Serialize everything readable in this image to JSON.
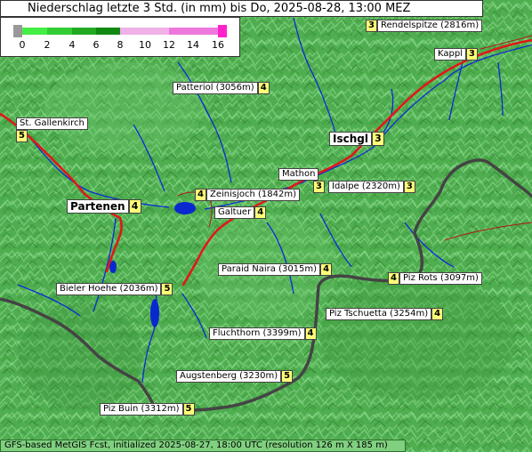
{
  "title": "Niederschlag letzte 3 Std. (in mm) bis Do, 2025-08-28, 13:00 MEZ",
  "footer": "GFS-based MetGIS Fcst, initialized 2025-08-27, 18:00 UTC  (resolution 126 m X 185 m)",
  "legend": {
    "ticks": [
      "0",
      "2",
      "4",
      "6",
      "8",
      "10",
      "12",
      "14",
      "16"
    ],
    "colors": {
      "zero": "#999999",
      "band_0_2": "#44ee44",
      "band_2_4": "#33cc33",
      "band_4_6": "#22aa22",
      "band_6_8": "#118811",
      "band_8_12": "#f0b0e8",
      "band_12_16": "#ee77dd",
      "max": "#ff22cc"
    }
  },
  "colors": {
    "terrain": "#4fae4f",
    "terrain_light": "#7fd07f",
    "river": "#0a2ad8",
    "road": "#e01818",
    "border": "#444444",
    "lake": "#0a28d0"
  },
  "places": [
    {
      "name": "Rendelspitze (2816m)",
      "value": "3"
    },
    {
      "name": "Kappl",
      "value": "3"
    },
    {
      "name": "Patteriol (3056m)",
      "value": "4"
    },
    {
      "name": "St. Gallenkirch",
      "value": "5"
    },
    {
      "name": "Ischgl",
      "value": "3"
    },
    {
      "name": "Mathon",
      "value": "3"
    },
    {
      "name": "Idalpe (2320m)",
      "value": "3"
    },
    {
      "name": "Zeinisjoch (1842m)",
      "value": "4"
    },
    {
      "name": "Partenen",
      "value": "4"
    },
    {
      "name": "Galtuer",
      "value": "4"
    },
    {
      "name": "Paraid Naira (3015m)",
      "value": "4"
    },
    {
      "name": "Piz Rots (3097m)",
      "value": "4"
    },
    {
      "name": "Bieler Hoehe (2036m)",
      "value": "5"
    },
    {
      "name": "Piz Tschuetta (3254m)",
      "value": "4"
    },
    {
      "name": "Fluchthorn (3399m)",
      "value": "4"
    },
    {
      "name": "Augstenberg (3230m)",
      "value": "5"
    },
    {
      "name": "Piz Buin (3312m)",
      "value": "5"
    }
  ]
}
